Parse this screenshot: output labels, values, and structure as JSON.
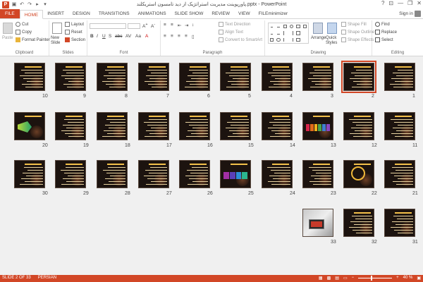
{
  "window": {
    "title": "پاورپوینت مدیریت استراتژیک از دید تامسون استریکلند.pptx - PowerPoint",
    "app_icon": "P",
    "controls": [
      "?",
      "⊡",
      "—",
      "❐",
      "✕"
    ]
  },
  "quick_access": [
    "save-icon",
    "undo-icon",
    "redo-icon",
    "present-icon",
    "customize-icon"
  ],
  "tabs": [
    "FILE",
    "HOME",
    "INSERT",
    "DESIGN",
    "TRANSITIONS",
    "ANIMATIONS",
    "SLIDE SHOW",
    "REVIEW",
    "VIEW",
    "FILEminimizer"
  ],
  "active_tab": "HOME",
  "sign_in": "Sign in",
  "ribbon": {
    "clipboard": {
      "label": "Clipboard",
      "paste": "Paste",
      "cut": "Cut",
      "copy": "Copy",
      "format_painter": "Format Painter"
    },
    "slides": {
      "label": "Slides",
      "new_slide": "New Slide",
      "layout": "Layout",
      "reset": "Reset",
      "section": "Section"
    },
    "font": {
      "label": "Font"
    },
    "paragraph": {
      "label": "Paragraph",
      "text_direction": "Text Direction",
      "align_text": "Align Text",
      "convert_smartart": "Convert to SmartArt"
    },
    "drawing": {
      "label": "Drawing",
      "arrange": "Arrange",
      "quick_styles": "Quick Styles",
      "shape_fill": "Shape Fill",
      "shape_outline": "Shape Outline",
      "shape_effects": "Shape Effects"
    },
    "editing": {
      "label": "Editing",
      "find": "Find",
      "replace": "Replace",
      "select": "Select"
    }
  },
  "slides": [
    {
      "n": "1",
      "kind": "text"
    },
    {
      "n": "2",
      "kind": "text",
      "selected": true
    },
    {
      "n": "3",
      "kind": "text"
    },
    {
      "n": "4",
      "kind": "text"
    },
    {
      "n": "5",
      "kind": "text"
    },
    {
      "n": "6",
      "kind": "text"
    },
    {
      "n": "7",
      "kind": "text"
    },
    {
      "n": "8",
      "kind": "text"
    },
    {
      "n": "9",
      "kind": "text"
    },
    {
      "n": "10",
      "kind": "text"
    },
    {
      "n": "11",
      "kind": "text"
    },
    {
      "n": "12",
      "kind": "text"
    },
    {
      "n": "13",
      "kind": "bars"
    },
    {
      "n": "14",
      "kind": "text"
    },
    {
      "n": "15",
      "kind": "text"
    },
    {
      "n": "16",
      "kind": "text"
    },
    {
      "n": "17",
      "kind": "text"
    },
    {
      "n": "18",
      "kind": "text"
    },
    {
      "n": "19",
      "kind": "text"
    },
    {
      "n": "20",
      "kind": "diagram"
    },
    {
      "n": "21",
      "kind": "text"
    },
    {
      "n": "22",
      "kind": "circle"
    },
    {
      "n": "23",
      "kind": "text"
    },
    {
      "n": "24",
      "kind": "text"
    },
    {
      "n": "25",
      "kind": "bars2"
    },
    {
      "n": "26",
      "kind": "text"
    },
    {
      "n": "27",
      "kind": "text"
    },
    {
      "n": "28",
      "kind": "text"
    },
    {
      "n": "29",
      "kind": "text"
    },
    {
      "n": "30",
      "kind": "text"
    },
    {
      "n": "31",
      "kind": "text"
    },
    {
      "n": "32",
      "kind": "text"
    },
    {
      "n": "33",
      "kind": "photo"
    }
  ],
  "status": {
    "slide_info": "SLIDE 2 OF 33",
    "language": "PERSIAN",
    "zoom_label": "40 %",
    "zoom_level": 0.4
  },
  "colors": {
    "accent": "#d24726",
    "slide_bg": "#1c130f",
    "slide_text": "#e8d3a0",
    "slide_heading": "#f3c04a"
  }
}
